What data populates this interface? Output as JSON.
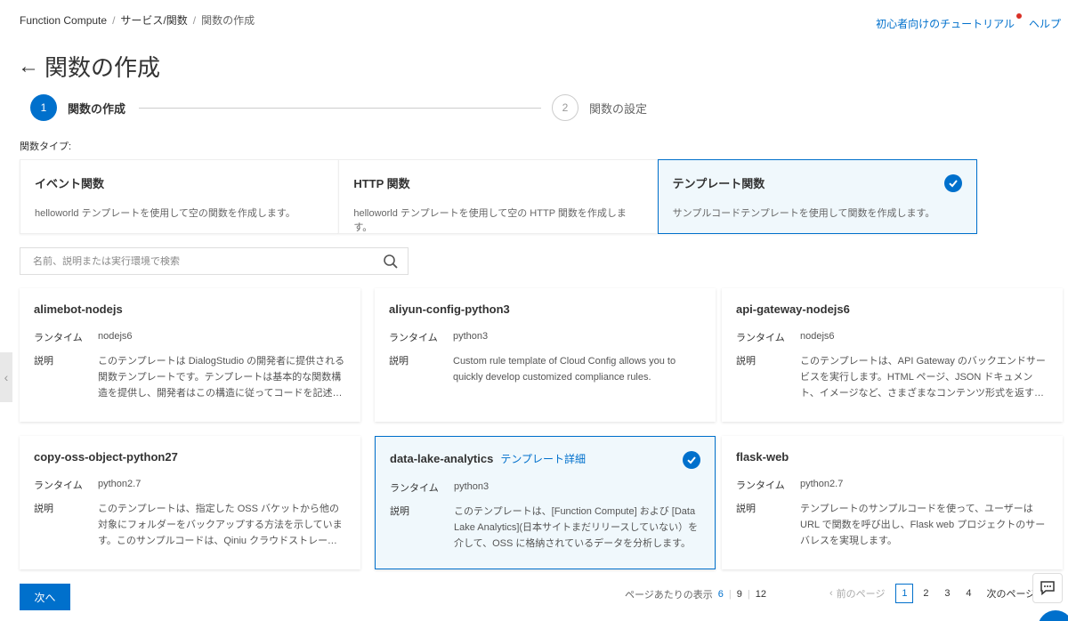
{
  "breadcrumb": [
    "Function Compute",
    "サービス/関数",
    "関数の作成"
  ],
  "top_links": {
    "tutorial": "初心者向けのチュートリアル",
    "help": "ヘルプ"
  },
  "title": "関数の作成",
  "steps": [
    {
      "num": "1",
      "label": "関数の作成"
    },
    {
      "num": "2",
      "label": "関数の設定"
    }
  ],
  "type_label": "関数タイプ:",
  "types": [
    {
      "title": "イベント関数",
      "desc": "helloworld テンプレートを使用して空の関数を作成します。"
    },
    {
      "title": "HTTP 関数",
      "desc": "helloworld テンプレートを使用して空の HTTP 関数を作成します。"
    },
    {
      "title": "テンプレート関数",
      "desc": "サンプルコードテンプレートを使用して関数を作成します。"
    }
  ],
  "search": {
    "placeholder": "名前、説明または実行環境で検索",
    "value": ""
  },
  "labels": {
    "runtime": "ランタイム",
    "desc": "説明",
    "detail": "テンプレート詳細"
  },
  "templates": [
    {
      "name": "alimebot-nodejs",
      "runtime": "nodejs6",
      "desc": "このテンプレートは DialogStudio の開発者に提供される関数テンプレートです。テンプレートは基本的な関数構造を提供し、開発者はこの構造に従ってコードを記述できます。"
    },
    {
      "name": "aliyun-config-python3",
      "runtime": "python3",
      "desc": "Custom rule template of Cloud Config allows you to quickly develop customized compliance rules."
    },
    {
      "name": "api-gateway-nodejs6",
      "runtime": "nodejs6",
      "desc": "このテンプレートは、API Gateway のバックエンドサービスを実行します。HTML ページ、JSON ドキュメント、イメージなど、さまざまなコンテンツ形式を返すことができます。"
    },
    {
      "name": "copy-oss-object-python27",
      "runtime": "python2.7",
      "desc": "このテンプレートは、指定した OSS バケットから他の対象にフォルダーをバックアップする方法を示しています。このサンプルコードは、Qiniu クラウドストレージにも適用できます。"
    },
    {
      "name": "data-lake-analytics",
      "runtime": "python3",
      "desc": "このテンプレートは、[Function Compute] および [Data Lake Analytics](日本サイトまだリリースしていない）を介して、OSS に格納されているデータを分析します。"
    },
    {
      "name": "flask-web",
      "runtime": "python2.7",
      "desc": "テンプレートのサンプルコードを使って、ユーザーは URL で関数を呼び出し、Flask web プロジェクトのサーバレスを実現します。"
    }
  ],
  "next_button": "次へ",
  "per_page": {
    "label": "ページあたりの表示",
    "options": [
      "6",
      "9",
      "12"
    ]
  },
  "pager": {
    "prev": "前のページ",
    "pages": [
      "1",
      "2",
      "3",
      "4"
    ],
    "next": "次のページ"
  }
}
